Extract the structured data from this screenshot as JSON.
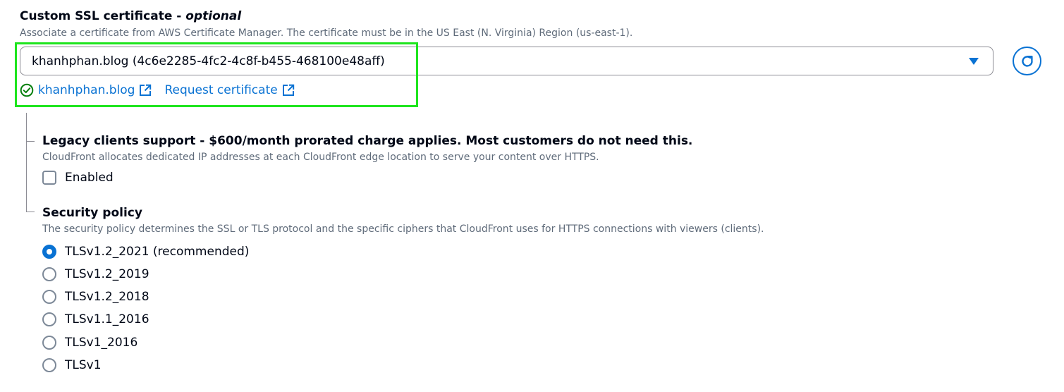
{
  "ssl": {
    "title": "Custom SSL certificate - ",
    "title_optional": "optional",
    "description": "Associate a certificate from AWS Certificate Manager. The certificate must be in the US East (N. Virginia) Region (us-east-1).",
    "selected_value": "khanhphan.blog (4c6e2285-4fc2-4c8f-b455-468100e48aff)",
    "cert_link_label": "khanhphan.blog",
    "request_link_label": "Request certificate"
  },
  "legacy": {
    "title": "Legacy clients support - $600/month prorated charge applies. Most customers do not need this.",
    "description": "CloudFront allocates dedicated IP addresses at each CloudFront edge location to serve your content over HTTPS.",
    "checkbox_label": "Enabled",
    "checked": false
  },
  "security": {
    "title": "Security policy",
    "description": "The security policy determines the SSL or TLS protocol and the specific ciphers that CloudFront uses for HTTPS connections with viewers (clients).",
    "options": [
      {
        "label": "TLSv1.2_2021 (recommended)",
        "selected": true
      },
      {
        "label": "TLSv1.2_2019",
        "selected": false
      },
      {
        "label": "TLSv1.2_2018",
        "selected": false
      },
      {
        "label": "TLSv1.1_2016",
        "selected": false
      },
      {
        "label": "TLSv1_2016",
        "selected": false
      },
      {
        "label": "TLSv1",
        "selected": false
      }
    ]
  },
  "colors": {
    "accent": "#0972d3",
    "highlight": "#1ee51e",
    "success": "#037f0c"
  }
}
